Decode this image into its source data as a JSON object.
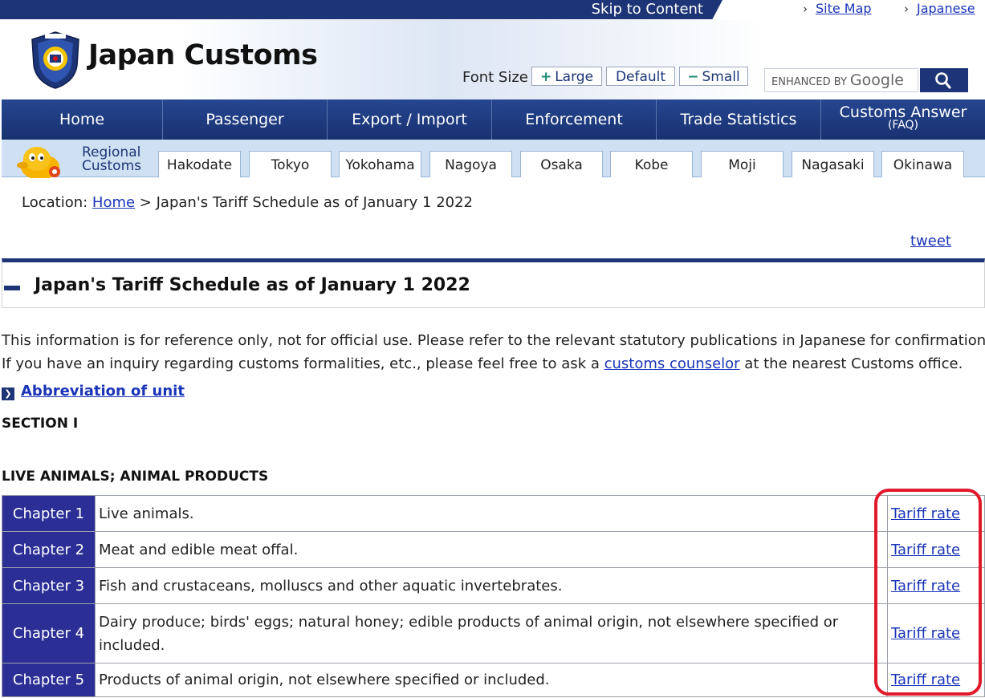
{
  "topbar": {
    "skip_label": "Skip to Content",
    "links": [
      {
        "label": "Site Map"
      },
      {
        "label": "Japanese"
      }
    ]
  },
  "header": {
    "site_title": "Japan Customs",
    "logo_icon": "customs-shield-emblem-icon",
    "font_size_label": "Font Size",
    "font_buttons": {
      "large": "Large",
      "default": "Default",
      "small": "Small"
    },
    "search": {
      "enhanced_by": "ENHANCED BY",
      "google": "Google",
      "button_icon": "magnifier-icon"
    }
  },
  "nav": {
    "items": [
      "Home",
      "Passenger",
      "Export / Import",
      "Enforcement",
      "Trade Statistics"
    ],
    "faq": {
      "label": "Customs Answer",
      "sub": "(FAQ)"
    }
  },
  "regional": {
    "label_line1": "Regional",
    "label_line2": "Customs",
    "cities": [
      "Hakodate",
      "Tokyo",
      "Yokohama",
      "Nagoya",
      "Osaka",
      "Kobe",
      "Moji",
      "Nagasaki",
      "Okinawa"
    ]
  },
  "breadcrumb": {
    "prefix": "Location: ",
    "home": "Home",
    "separator": " > ",
    "current": "Japan's Tariff Schedule as of January 1 2022"
  },
  "tweet_label": "tweet",
  "page_title": "Japan's Tariff Schedule as of January 1 2022",
  "intro": {
    "line1": "This information is for reference only, not for official use. Please refer to the relevant statutory publications in Japanese for confirmation.",
    "line2_before": "If you have an inquiry regarding customs formalities, etc., please feel free to ask a ",
    "line2_link": "customs counselor",
    "line2_after": " at the nearest Customs office."
  },
  "abbreviation_link": "Abbreviation of unit",
  "section_heading": "SECTION I",
  "section_subheading": "LIVE ANIMALS; ANIMAL PRODUCTS",
  "chapters": [
    {
      "chapter": "Chapter 1",
      "description": "Live animals.",
      "link": "Tariff rate"
    },
    {
      "chapter": "Chapter 2",
      "description": "Meat and edible meat offal.",
      "link": "Tariff rate"
    },
    {
      "chapter": "Chapter 3",
      "description": "Fish and crustaceans, molluscs and other aquatic invertebrates.",
      "link": "Tariff rate"
    },
    {
      "chapter": "Chapter 4",
      "description": "Dairy produce; birds' eggs; natural honey; edible products of animal origin, not elsewhere specified or included.",
      "link": "Tariff rate"
    },
    {
      "chapter": "Chapter 5",
      "description": "Products of animal origin, not elsewhere specified or included.",
      "link": "Tariff rate"
    }
  ],
  "colors": {
    "navy": "#1d3576",
    "chapter_cell": "#2b2f95",
    "regional_bar": "#cfe0f3",
    "link": "#1a34b8",
    "highlight": "#e0192b"
  }
}
